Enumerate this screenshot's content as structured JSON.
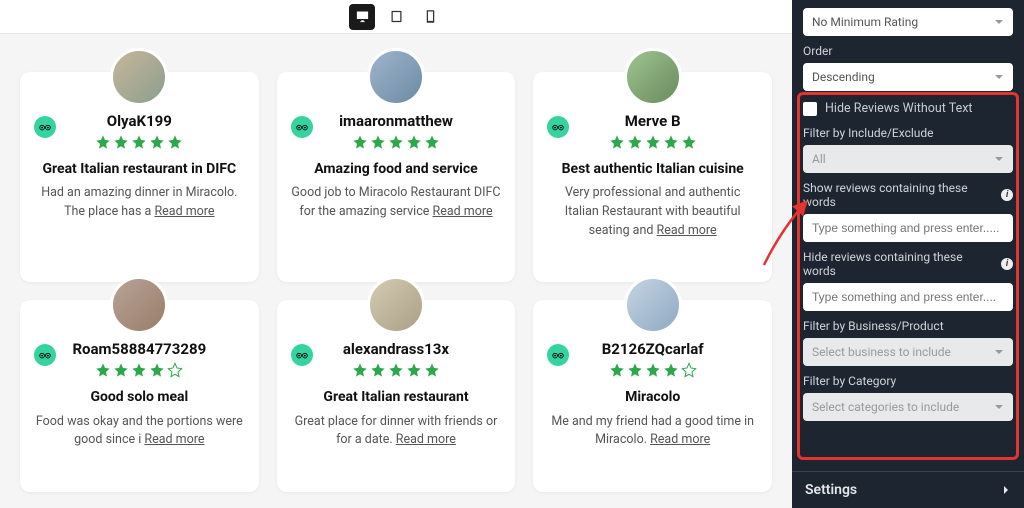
{
  "reviews": [
    {
      "username": "OlyaK199",
      "rating": 5,
      "title": "Great Italian restaurant in DIFC",
      "desc": "Had an amazing dinner in Miracolo. The place has a ",
      "readmore": "Read more",
      "avatar": "av1"
    },
    {
      "username": "imaaronmatthew",
      "rating": 5,
      "title": "Amazing food and service",
      "desc": "Good job to Miracolo Restaurant DIFC for the amazing service ",
      "readmore": "Read more",
      "avatar": "av2"
    },
    {
      "username": "Merve B",
      "rating": 5,
      "title": "Best authentic Italian cuisine",
      "desc": "Very professional and authentic Italian Restaurant with beautiful seating and ",
      "readmore": "Read more",
      "avatar": "av3"
    },
    {
      "username": "Roam58884773289",
      "rating": 4,
      "title": "Good solo meal",
      "desc": "Food was okay and the portions were good since i ",
      "readmore": "Read more",
      "avatar": "av4"
    },
    {
      "username": "alexandrass13x",
      "rating": 5,
      "title": "Great Italian restaurant",
      "desc": "Great place for dinner with friends or for a date. ",
      "readmore": "Read more",
      "avatar": "av5"
    },
    {
      "username": "B2126ZQcarlaf",
      "rating": 4,
      "title": "Miracolo",
      "desc": "Me and my friend had a good time in Miracolo. ",
      "readmore": "Read more",
      "avatar": "av6"
    }
  ],
  "panel": {
    "min_rating": {
      "label": "",
      "value": "No Minimum Rating"
    },
    "order": {
      "label": "Order",
      "value": "Descending"
    },
    "hide_no_text": "Hide Reviews Without Text",
    "filter_include": {
      "label": "Filter by Include/Exclude",
      "value": "All"
    },
    "show_words": {
      "label": "Show reviews containing these words",
      "placeholder": "Type something and press enter....."
    },
    "hide_words": {
      "label": "Hide reviews containing these words",
      "placeholder": "Type something and press enter...."
    },
    "filter_business": {
      "label": "Filter by Business/Product",
      "placeholder": "Select business to include"
    },
    "filter_category": {
      "label": "Filter by Category",
      "placeholder": "Select categories to include"
    },
    "settings": "Settings"
  }
}
